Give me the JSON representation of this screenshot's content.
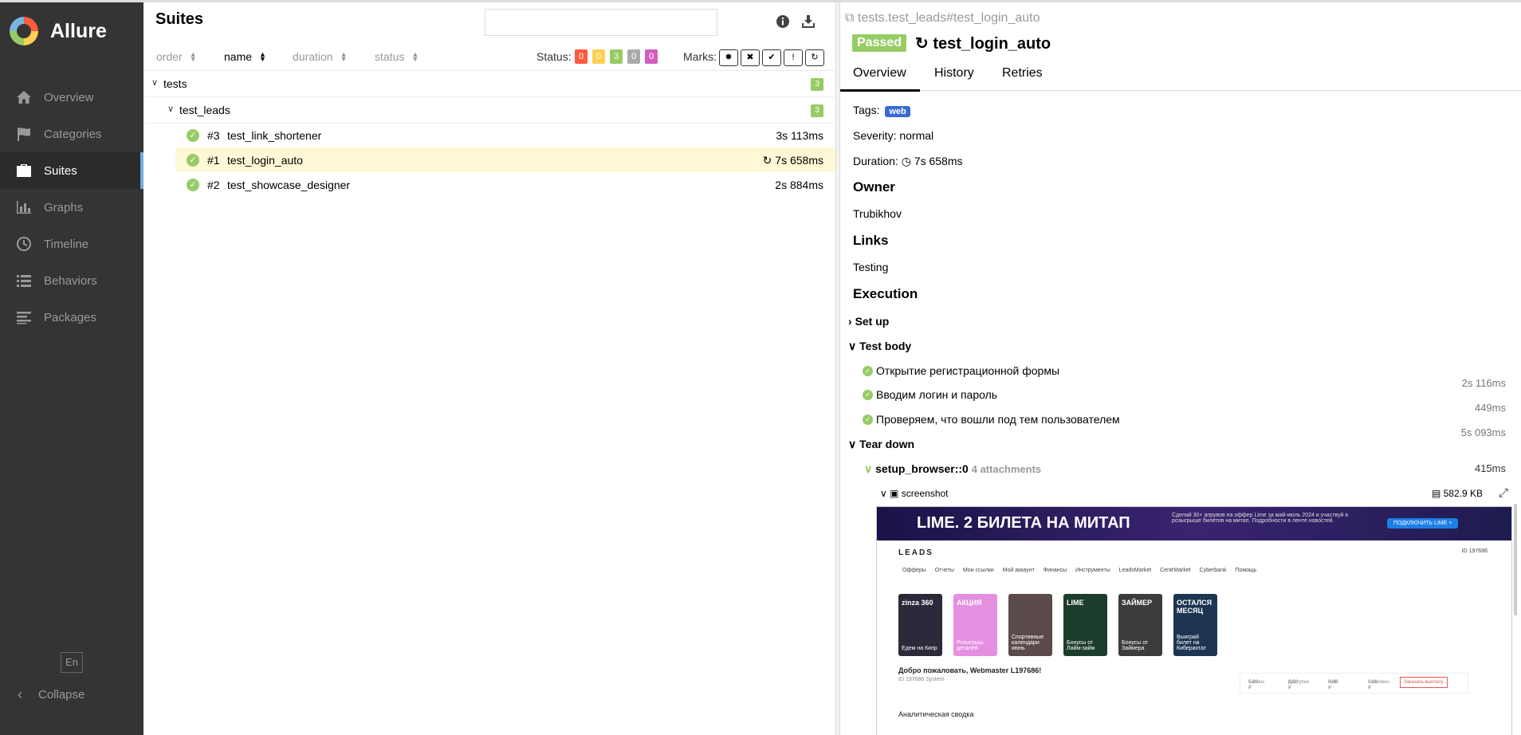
{
  "app": {
    "name": "Allure"
  },
  "sidebar": {
    "items": [
      {
        "label": "Overview",
        "icon": "home-icon"
      },
      {
        "label": "Categories",
        "icon": "flag-icon"
      },
      {
        "label": "Suites",
        "icon": "briefcase-icon",
        "active": true
      },
      {
        "label": "Graphs",
        "icon": "bar-chart-icon"
      },
      {
        "label": "Timeline",
        "icon": "clock-icon"
      },
      {
        "label": "Behaviors",
        "icon": "list-icon"
      },
      {
        "label": "Packages",
        "icon": "align-left-icon"
      }
    ],
    "language": "En",
    "collapse": "Collapse"
  },
  "suites": {
    "title": "Suites",
    "search_value": "",
    "columns": {
      "order": "order",
      "name": "name",
      "duration": "duration",
      "status": "status"
    },
    "status_label": "Status:",
    "status_counts": [
      {
        "value": "0",
        "color": "#fd5a3e"
      },
      {
        "value": "0",
        "color": "#ffd050"
      },
      {
        "value": "3",
        "color": "#97cc64"
      },
      {
        "value": "0",
        "color": "#aaaaaa"
      },
      {
        "value": "0",
        "color": "#d35ebe"
      }
    ],
    "marks_label": "Marks:",
    "tree": {
      "root": {
        "label": "tests",
        "count": "3"
      },
      "child": {
        "label": "test_leads",
        "count": "3"
      }
    },
    "tests": [
      {
        "num": "#3",
        "name": "test_link_shortener",
        "duration": "3s 113ms",
        "retried": false
      },
      {
        "num": "#1",
        "name": "test_login_auto",
        "duration": "7s 658ms",
        "retried": true,
        "selected": true
      },
      {
        "num": "#2",
        "name": "test_showcase_designer",
        "duration": "2s 884ms",
        "retried": false
      }
    ]
  },
  "detail": {
    "path": "tests.test_leads#test_login_auto",
    "status": "Passed",
    "name": "test_login_auto",
    "tabs": [
      "Overview",
      "History",
      "Retries"
    ],
    "tags_label": "Tags:",
    "tag": "web",
    "severity": "Severity: normal",
    "duration_label": "Duration:",
    "duration": "7s 658ms",
    "owner_heading": "Owner",
    "owner": "Trubikhov",
    "links_heading": "Links",
    "link": "Testing",
    "execution_heading": "Execution",
    "setup": "Set up",
    "test_body": "Test body",
    "steps": [
      {
        "label": "Открытие регистрационной формы",
        "time": "2s 116ms"
      },
      {
        "label": "Вводим логин и пароль",
        "time": "449ms"
      },
      {
        "label": "Проверяем, что вошли под тем пользователем",
        "time": "5s 093ms"
      }
    ],
    "teardown": "Tear down",
    "fixture": {
      "name": "setup_browser::0",
      "attachments": "4 attachments",
      "time": "415ms"
    },
    "attachment": {
      "name": "screenshot",
      "size": "582.9 KB"
    }
  },
  "screenshot": {
    "banner_title": "LIME. 2 БИЛЕТА НА МИТАП",
    "banner_text": "Сделай 30+ апрувов на оффер Lime за май-июль 2024 и участвуй в розыгрыше билетов на митап. Подробности в ленте новостей.",
    "banner_button": "ПОДКЛЮЧИТЬ LIME +",
    "logo": "LEADS",
    "menu": [
      "Офферы",
      "Отчеты",
      "Мои ссылки",
      "Мой аккаунт",
      "Финансы",
      "Инструменты",
      "LeadsMarket",
      "CentrMarket",
      "Cyberbank",
      "Помощь"
    ],
    "user_id": "ID 197686",
    "cards": [
      {
        "title": "zinza 360",
        "caption": "Едем на Кипр",
        "color": "#2a2a3a"
      },
      {
        "title": "АКЦИЯ",
        "caption": "Розыгрыш деталей",
        "color": "#e58fe0"
      },
      {
        "title": "",
        "caption": "Спортивные календари июнь",
        "color": "#5a4a4a"
      },
      {
        "title": "LIME",
        "caption": "Бонусы от Лайм-займ",
        "color": "#1b3d2c"
      },
      {
        "title": "ЗАЙМЕР",
        "caption": "Бонусы от Займера",
        "color": "#3c3c3c"
      },
      {
        "title": "ОСТАЛСЯ МЕСЯЦ",
        "caption": "Выиграй билет на Киберахтат",
        "color": "#1d3552"
      }
    ],
    "welcome": "Добро пожаловать, Webmaster L197686!",
    "id_line": "ID 197686   System",
    "balance": [
      {
        "label": "Баланс",
        "value": "0,00 ₽"
      },
      {
        "label": "Доступно",
        "value": "0,00 ₽"
      },
      {
        "label": "Hold",
        "value": "0,00 ₽"
      },
      {
        "label": "Заявлено",
        "value": "0,00 ₽"
      }
    ],
    "payout": "Заказать выплату",
    "analytics": "Аналитическая сводка"
  }
}
